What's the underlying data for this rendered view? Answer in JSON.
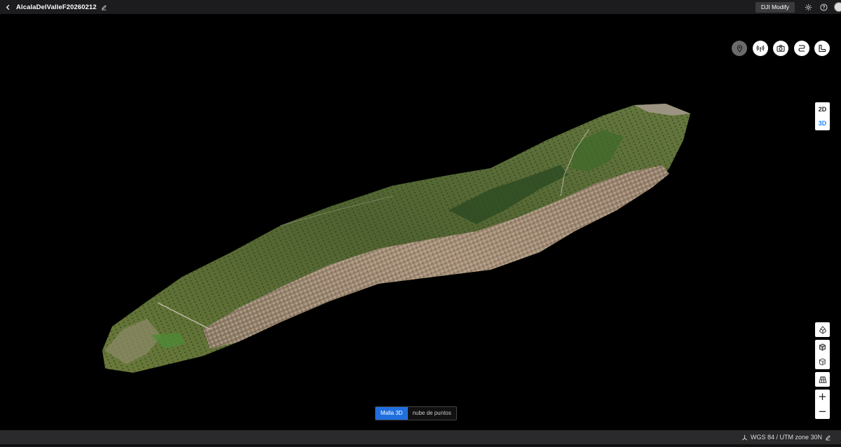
{
  "header": {
    "project_title": "AlcalaDelValleF20260212",
    "brand_button": "DJI Modify"
  },
  "view_modes": {
    "options": [
      "2D",
      "3D"
    ],
    "selected": "3D"
  },
  "display_modes": {
    "mesh_label": "Malla 3D",
    "pointcloud_label": "nube de puntos",
    "selected": "Malla 3D"
  },
  "zoom": {
    "in_label": "+",
    "out_label": "−"
  },
  "status": {
    "coordinate_system": "WGS 84 / UTM zone 30N"
  },
  "colors": {
    "accent": "#1f6fe0",
    "toolbar_bg": "#1c1c1e",
    "active_dim": "#1f86ff"
  }
}
